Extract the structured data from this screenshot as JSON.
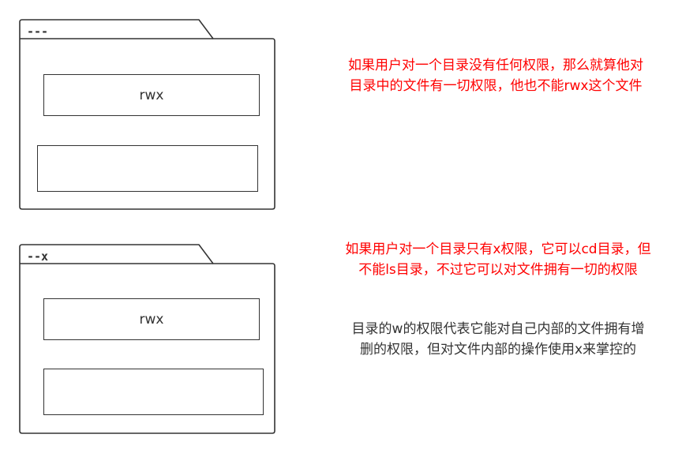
{
  "colors": {
    "outline": "#333333",
    "note_red": "#ff0000",
    "note_dark": "#333333",
    "background": "#ffffff"
  },
  "folders": [
    {
      "label": "---",
      "inner_boxes": [
        {
          "text": "rwx"
        },
        {
          "text": ""
        }
      ]
    },
    {
      "label": "--x",
      "inner_boxes": [
        {
          "text": "rwx"
        },
        {
          "text": ""
        }
      ]
    }
  ],
  "notes": {
    "no_permission": {
      "line1": "如果用户对一个目录没有任何权限，那么就算他对",
      "line2": "目录中的文件有一切权限，他也不能rwx这个文件"
    },
    "x_only": {
      "line1": "如果用户对一个目录只有x权限，它可以cd目录，但",
      "line2": "不能ls目录，不过它可以对文件拥有一切的权限"
    },
    "w_permission": {
      "line1": "目录的w的权限代表它能对自己内部的文件拥有增",
      "line2": "删的权限，但对文件内部的操作使用x来掌控的"
    }
  }
}
